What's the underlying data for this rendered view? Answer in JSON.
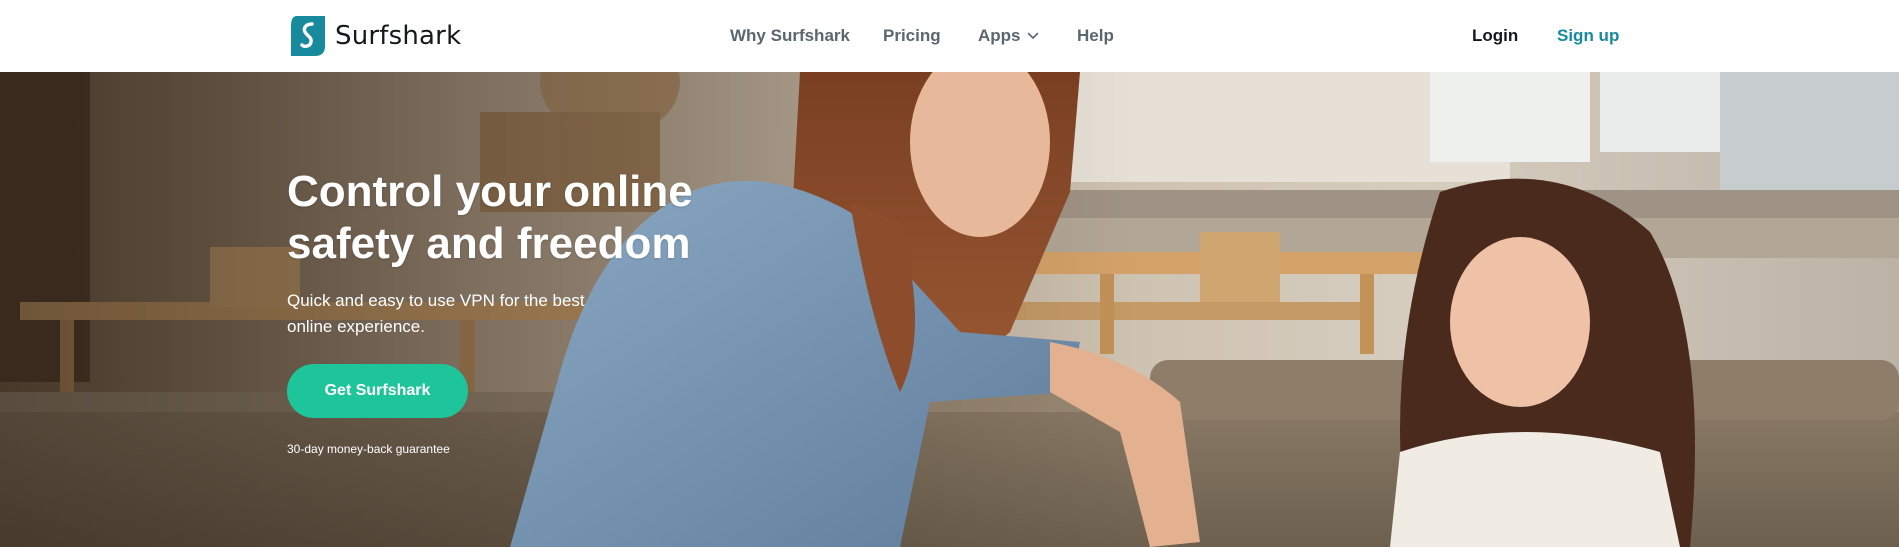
{
  "brand": {
    "name": "Surfshark",
    "logo_icon": "surfshark-s-icon",
    "accent_color": "#1ec59b",
    "logo_color": "#178a9e"
  },
  "nav": {
    "items": [
      {
        "label": "Why Surfshark"
      },
      {
        "label": "Pricing"
      },
      {
        "label": "Apps",
        "icon": "chevron-down-icon"
      },
      {
        "label": "Help"
      }
    ]
  },
  "auth": {
    "login_label": "Login",
    "signup_label": "Sign up"
  },
  "hero": {
    "title": "Control your online safety and freedom",
    "subtitle": "Quick and easy to use VPN for the best online experience.",
    "cta_label": "Get Surfshark",
    "guarantee": "30-day money-back guarantee"
  }
}
